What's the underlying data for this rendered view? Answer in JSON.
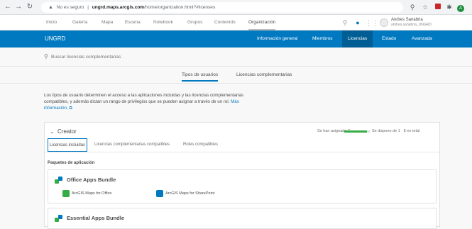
{
  "browser": {
    "security_label": "No es seguro",
    "url_host": "ungrd.maps.arcgis.com",
    "url_path": "/home/organization.html?#licenses"
  },
  "topnav": {
    "items": [
      "Inicio",
      "Galería",
      "Mapa",
      "Escena",
      "Notebook",
      "Grupos",
      "Contenido",
      "Organización"
    ],
    "user_name": "Andres Sanabria",
    "user_email": "andres.sanabria_UNGRD"
  },
  "orgbar": {
    "org_name": "UNGRD",
    "tabs": [
      "Información general",
      "Miembros",
      "Licencias",
      "Estado",
      "Avanzada"
    ]
  },
  "search": {
    "placeholder": "Buscar licencias complementarias"
  },
  "subtabs": {
    "user_types": "Tipos de usuarios",
    "addon_licenses": "Licencias complementarias"
  },
  "description": {
    "text": "Los tipos de usuario determinen el acceso a las aplicaciones incluidas y las licencias complementarias compatibles, y además dictan un rango de privilegios que se pueden asignar a través de un rol.",
    "link": "Más información."
  },
  "card": {
    "title": "Creator",
    "assigned_label": "Se han asignado 7",
    "available_label": "Se dispone de 1 · 8 en total",
    "assigned_fraction": 0.875,
    "tabs": [
      "Licencias incluidas",
      "Licencias complementarias compatibles",
      "Roles compatibles"
    ],
    "packages_heading": "Paquetes de aplicación",
    "bundles": [
      {
        "title": "Office Apps Bundle",
        "apps": [
          "ArcGIS Maps for Office",
          "ArcGIS Maps for SharePoint"
        ]
      },
      {
        "title": "Essential Apps Bundle",
        "apps": []
      }
    ]
  },
  "colors": {
    "brand_blue": "#0079c1",
    "active_tab_blue": "#005e95",
    "progress_green": "#35ac46"
  }
}
